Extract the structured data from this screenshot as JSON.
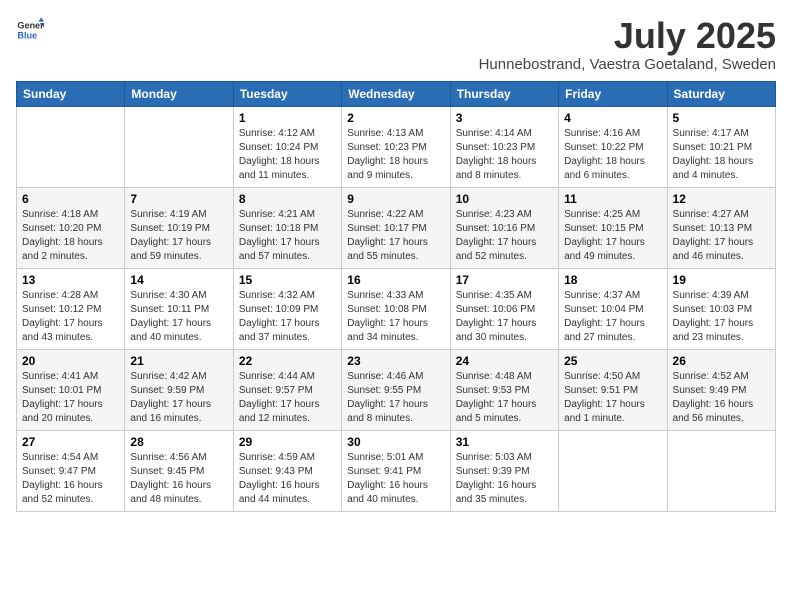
{
  "header": {
    "logo_line1": "General",
    "logo_line2": "Blue",
    "month": "July 2025",
    "location": "Hunnebostrand, Vaestra Goetaland, Sweden"
  },
  "weekdays": [
    "Sunday",
    "Monday",
    "Tuesday",
    "Wednesday",
    "Thursday",
    "Friday",
    "Saturday"
  ],
  "weeks": [
    [
      {
        "day": "",
        "empty": true
      },
      {
        "day": "",
        "empty": true
      },
      {
        "day": "1",
        "sunrise": "4:12 AM",
        "sunset": "10:24 PM",
        "daylight": "18 hours and 11 minutes."
      },
      {
        "day": "2",
        "sunrise": "4:13 AM",
        "sunset": "10:23 PM",
        "daylight": "18 hours and 9 minutes."
      },
      {
        "day": "3",
        "sunrise": "4:14 AM",
        "sunset": "10:23 PM",
        "daylight": "18 hours and 8 minutes."
      },
      {
        "day": "4",
        "sunrise": "4:16 AM",
        "sunset": "10:22 PM",
        "daylight": "18 hours and 6 minutes."
      },
      {
        "day": "5",
        "sunrise": "4:17 AM",
        "sunset": "10:21 PM",
        "daylight": "18 hours and 4 minutes."
      }
    ],
    [
      {
        "day": "6",
        "sunrise": "4:18 AM",
        "sunset": "10:20 PM",
        "daylight": "18 hours and 2 minutes."
      },
      {
        "day": "7",
        "sunrise": "4:19 AM",
        "sunset": "10:19 PM",
        "daylight": "17 hours and 59 minutes."
      },
      {
        "day": "8",
        "sunrise": "4:21 AM",
        "sunset": "10:18 PM",
        "daylight": "17 hours and 57 minutes."
      },
      {
        "day": "9",
        "sunrise": "4:22 AM",
        "sunset": "10:17 PM",
        "daylight": "17 hours and 55 minutes."
      },
      {
        "day": "10",
        "sunrise": "4:23 AM",
        "sunset": "10:16 PM",
        "daylight": "17 hours and 52 minutes."
      },
      {
        "day": "11",
        "sunrise": "4:25 AM",
        "sunset": "10:15 PM",
        "daylight": "17 hours and 49 minutes."
      },
      {
        "day": "12",
        "sunrise": "4:27 AM",
        "sunset": "10:13 PM",
        "daylight": "17 hours and 46 minutes."
      }
    ],
    [
      {
        "day": "13",
        "sunrise": "4:28 AM",
        "sunset": "10:12 PM",
        "daylight": "17 hours and 43 minutes."
      },
      {
        "day": "14",
        "sunrise": "4:30 AM",
        "sunset": "10:11 PM",
        "daylight": "17 hours and 40 minutes."
      },
      {
        "day": "15",
        "sunrise": "4:32 AM",
        "sunset": "10:09 PM",
        "daylight": "17 hours and 37 minutes."
      },
      {
        "day": "16",
        "sunrise": "4:33 AM",
        "sunset": "10:08 PM",
        "daylight": "17 hours and 34 minutes."
      },
      {
        "day": "17",
        "sunrise": "4:35 AM",
        "sunset": "10:06 PM",
        "daylight": "17 hours and 30 minutes."
      },
      {
        "day": "18",
        "sunrise": "4:37 AM",
        "sunset": "10:04 PM",
        "daylight": "17 hours and 27 minutes."
      },
      {
        "day": "19",
        "sunrise": "4:39 AM",
        "sunset": "10:03 PM",
        "daylight": "17 hours and 23 minutes."
      }
    ],
    [
      {
        "day": "20",
        "sunrise": "4:41 AM",
        "sunset": "10:01 PM",
        "daylight": "17 hours and 20 minutes."
      },
      {
        "day": "21",
        "sunrise": "4:42 AM",
        "sunset": "9:59 PM",
        "daylight": "17 hours and 16 minutes."
      },
      {
        "day": "22",
        "sunrise": "4:44 AM",
        "sunset": "9:57 PM",
        "daylight": "17 hours and 12 minutes."
      },
      {
        "day": "23",
        "sunrise": "4:46 AM",
        "sunset": "9:55 PM",
        "daylight": "17 hours and 8 minutes."
      },
      {
        "day": "24",
        "sunrise": "4:48 AM",
        "sunset": "9:53 PM",
        "daylight": "17 hours and 5 minutes."
      },
      {
        "day": "25",
        "sunrise": "4:50 AM",
        "sunset": "9:51 PM",
        "daylight": "17 hours and 1 minute."
      },
      {
        "day": "26",
        "sunrise": "4:52 AM",
        "sunset": "9:49 PM",
        "daylight": "16 hours and 56 minutes."
      }
    ],
    [
      {
        "day": "27",
        "sunrise": "4:54 AM",
        "sunset": "9:47 PM",
        "daylight": "16 hours and 52 minutes."
      },
      {
        "day": "28",
        "sunrise": "4:56 AM",
        "sunset": "9:45 PM",
        "daylight": "16 hours and 48 minutes."
      },
      {
        "day": "29",
        "sunrise": "4:59 AM",
        "sunset": "9:43 PM",
        "daylight": "16 hours and 44 minutes."
      },
      {
        "day": "30",
        "sunrise": "5:01 AM",
        "sunset": "9:41 PM",
        "daylight": "16 hours and 40 minutes."
      },
      {
        "day": "31",
        "sunrise": "5:03 AM",
        "sunset": "9:39 PM",
        "daylight": "16 hours and 35 minutes."
      },
      {
        "day": "",
        "empty": true
      },
      {
        "day": "",
        "empty": true
      }
    ]
  ],
  "labels": {
    "sunrise": "Sunrise:",
    "sunset": "Sunset:",
    "daylight": "Daylight:"
  }
}
